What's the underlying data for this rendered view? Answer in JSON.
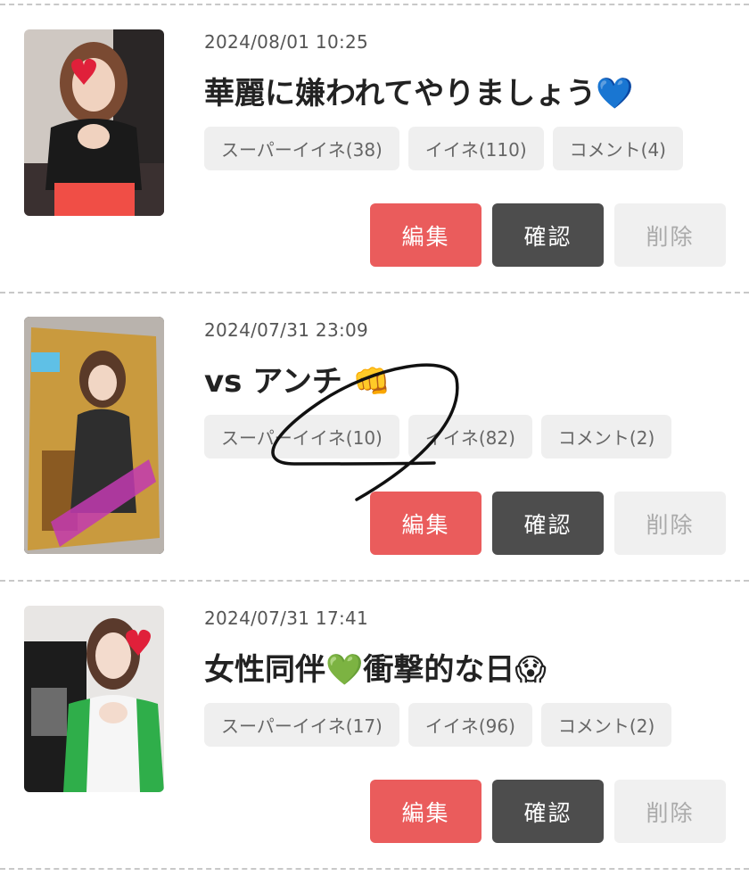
{
  "posts": [
    {
      "date": "2024/08/01 10:25",
      "title": "華麗に嫌われてやりましょう",
      "title_emoji": "💙",
      "tags": [
        "スーパーイイネ(38)",
        "イイネ(110)",
        "コメント(4)"
      ],
      "buttons": {
        "edit": "編集",
        "confirm": "確認",
        "delete": "削除"
      }
    },
    {
      "date": "2024/07/31 23:09",
      "title": "vs アンチ",
      "title_emoji": "👊",
      "tags": [
        "スーパーイイネ(10)",
        "イイネ(82)",
        "コメント(2)"
      ],
      "buttons": {
        "edit": "編集",
        "confirm": "確認",
        "delete": "削除"
      }
    },
    {
      "date": "2024/07/31 17:41",
      "title": "女性同伴💚衝撃的な日",
      "title_emoji": "😱",
      "tags": [
        "スーパーイイネ(17)",
        "イイネ(96)",
        "コメント(2)"
      ],
      "buttons": {
        "edit": "編集",
        "confirm": "確認",
        "delete": "削除"
      }
    }
  ],
  "colors": {
    "edit": "#ea5c5c",
    "confirm": "#4d4d4d",
    "delete": "#f0f0f0",
    "tag_bg": "#efefef"
  }
}
